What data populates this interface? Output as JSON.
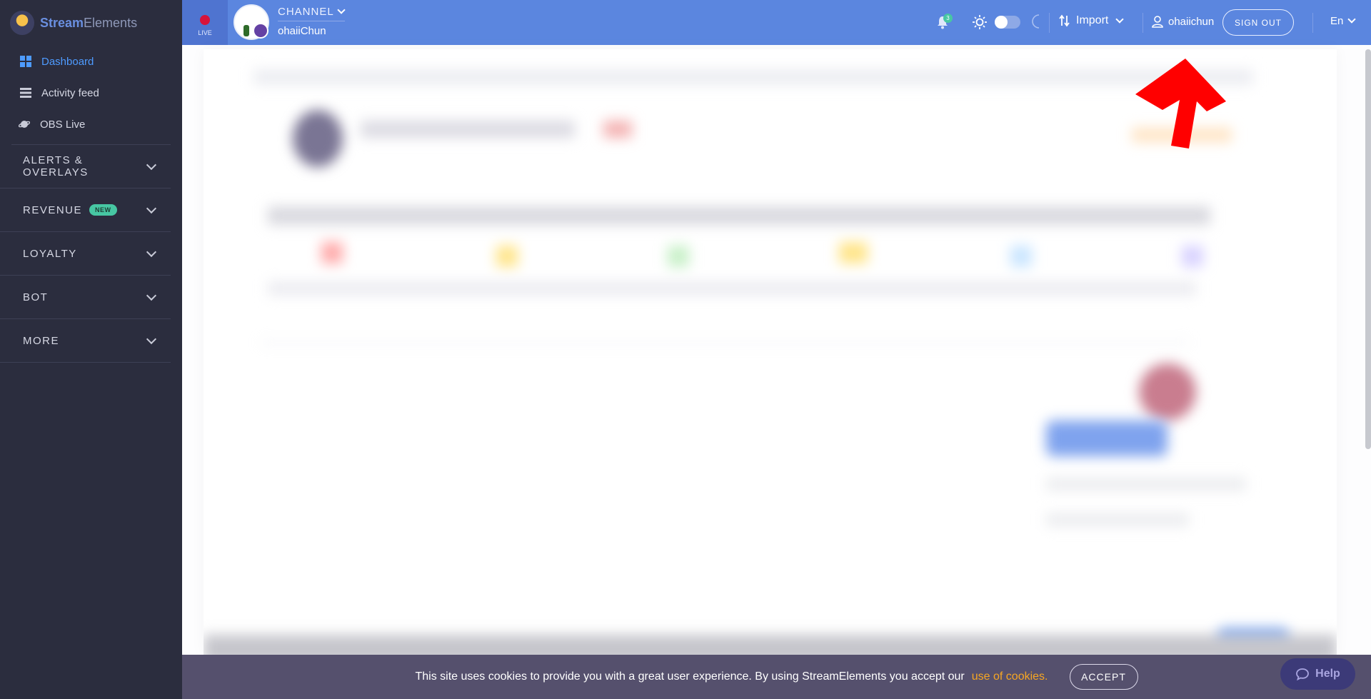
{
  "brand": {
    "name_a": "Stream",
    "name_b": "Elements"
  },
  "sidebar": {
    "links": [
      {
        "label": "Dashboard",
        "icon": "dashboard-icon",
        "active": true
      },
      {
        "label": "Activity feed",
        "icon": "list-icon",
        "active": false
      },
      {
        "label": "OBS Live",
        "icon": "planet-icon",
        "active": false
      }
    ],
    "sections": [
      {
        "label": "ALERTS & OVERLAYS"
      },
      {
        "label": "REVENUE",
        "badge": "NEW"
      },
      {
        "label": "LOYALTY"
      },
      {
        "label": "BOT"
      },
      {
        "label": "MORE"
      }
    ]
  },
  "topbar": {
    "live_label": "LIVE",
    "channel_label": "CHANNEL",
    "channel_name": "ohaiiChun",
    "notification_count": "3",
    "import_label": "Import",
    "username": "ohaiichun",
    "signout_label": "SIGN OUT",
    "language": "En"
  },
  "cookie_bar": {
    "message": "This site uses cookies to provide you with a great user experience. By using StreamElements you accept our",
    "link": "use of cookies.",
    "accept_label": "ACCEPT"
  },
  "help": {
    "label": "Help"
  },
  "colors": {
    "topbar": "#5b86df",
    "sidebar": "#2b2d3e",
    "live": "#d7133a",
    "accent": "#4e9bff",
    "annotation_arrow": "#ff0000"
  }
}
